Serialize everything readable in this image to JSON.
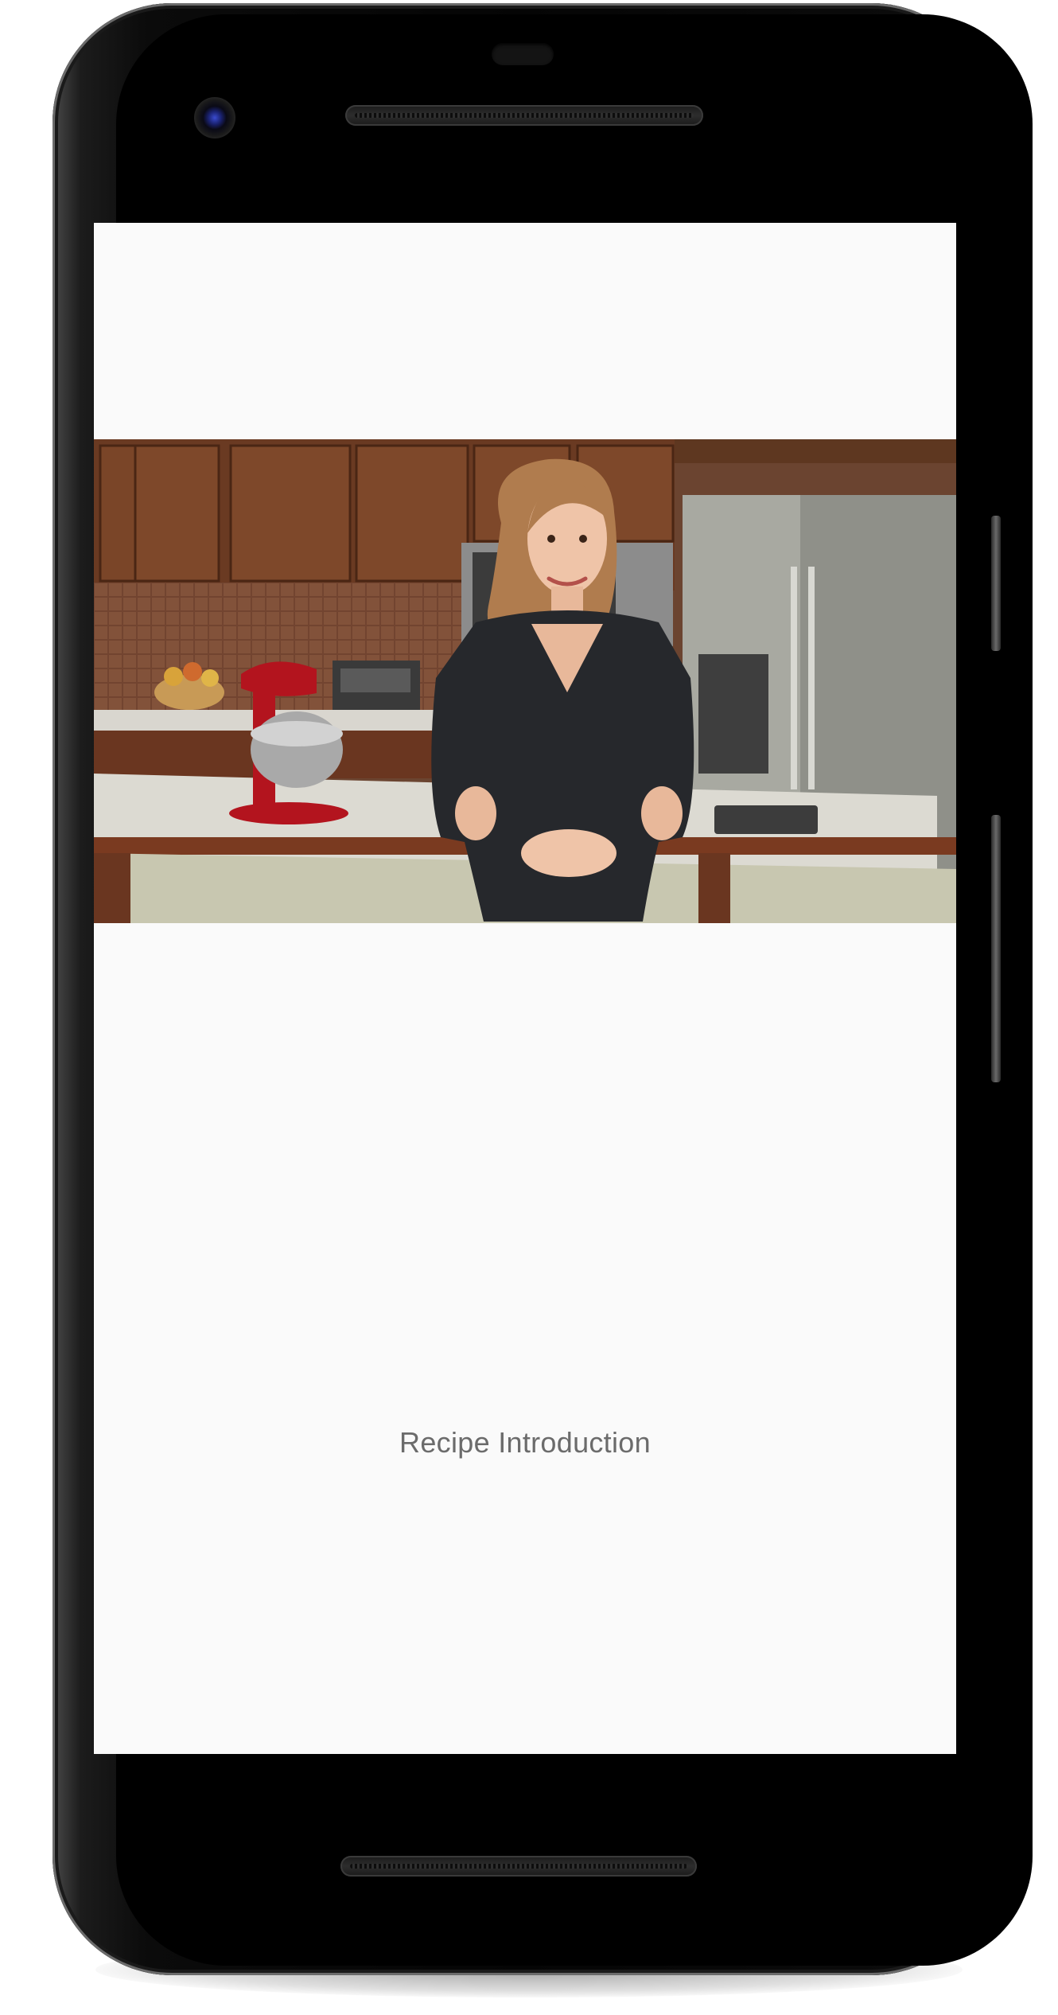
{
  "app": {
    "screen_title": "Recipe Introduction"
  },
  "video": {
    "icon": "video-frame",
    "subject": "host-in-kitchen"
  },
  "device": {
    "model_icon": "android-phone",
    "colors": {
      "screen_background": "#fafafa",
      "title_text": "#6b6b6b",
      "bezel": "#050505"
    }
  }
}
